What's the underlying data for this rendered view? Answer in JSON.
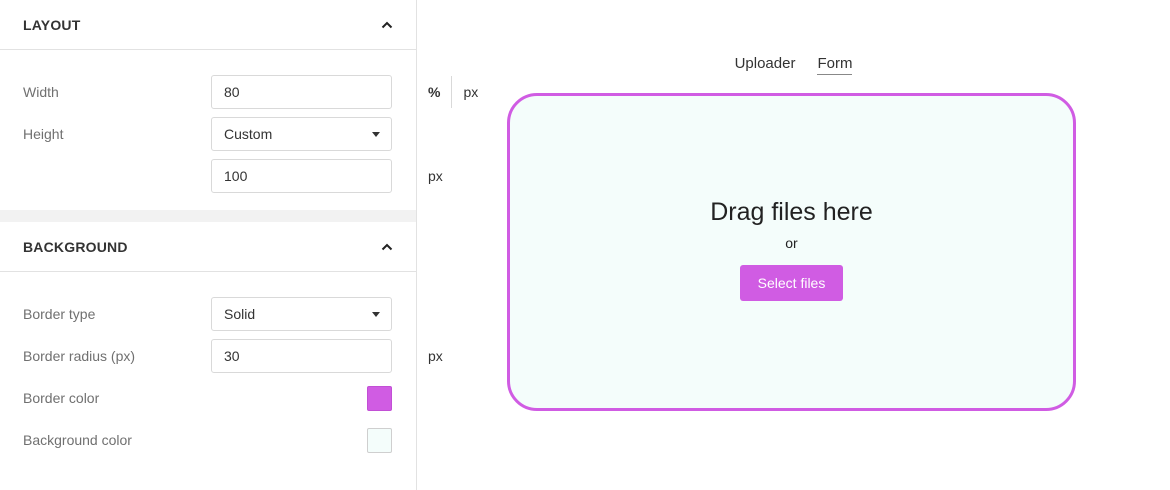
{
  "layout": {
    "title": "LAYOUT",
    "width": {
      "label": "Width",
      "value": "80",
      "units": [
        "%",
        "px"
      ],
      "active_unit": "%"
    },
    "height": {
      "label": "Height",
      "selected": "Custom",
      "value": "100",
      "unit": "px"
    }
  },
  "background": {
    "title": "BACKGROUND",
    "border_type": {
      "label": "Border type",
      "selected": "Solid"
    },
    "border_radius": {
      "label": "Border radius (px)",
      "value": "30",
      "unit": "px"
    },
    "border_color": {
      "label": "Border color",
      "color": "#d05ce3"
    },
    "background_color": {
      "label": "Background color",
      "color": "#f4fdfb"
    }
  },
  "preview": {
    "tabs": [
      "Uploader",
      "Form"
    ],
    "active_tab": "Form",
    "dropzone": {
      "title": "Drag files here",
      "or_text": "or",
      "button_label": "Select files"
    }
  },
  "colors": {
    "accent": "#d05ce3",
    "dropzone_bg": "#f4fdfb"
  },
  "icons": [
    "chevron-up-icon",
    "caret-down-icon"
  ]
}
